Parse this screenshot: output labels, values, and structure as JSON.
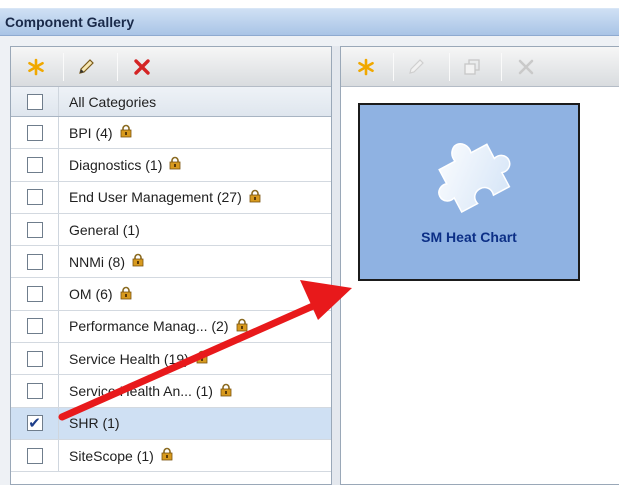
{
  "window": {
    "title": "Component Gallery"
  },
  "left_toolbar": {
    "buttons": [
      {
        "name": "new-icon",
        "color": "#f0a800"
      },
      {
        "name": "edit-icon",
        "color": "#8a6a2a"
      },
      {
        "name": "delete-icon",
        "color": "#d42424"
      }
    ]
  },
  "categories": {
    "header_label": "All Categories",
    "items": [
      {
        "label": "BPI (4)",
        "locked": true,
        "checked": false
      },
      {
        "label": "Diagnostics (1)",
        "locked": true,
        "checked": false
      },
      {
        "label": "End User Management (27)",
        "locked": true,
        "checked": false
      },
      {
        "label": "General (1)",
        "locked": false,
        "checked": false
      },
      {
        "label": "NNMi (8)",
        "locked": true,
        "checked": false
      },
      {
        "label": "OM (6)",
        "locked": true,
        "checked": false
      },
      {
        "label": "Performance Manag... (2)",
        "locked": true,
        "checked": false
      },
      {
        "label": "Service Health (19)",
        "locked": true,
        "checked": false
      },
      {
        "label": "Service Health An... (1)",
        "locked": true,
        "checked": false
      },
      {
        "label": "SHR (1)",
        "locked": false,
        "checked": true
      },
      {
        "label": "SiteScope (1)",
        "locked": true,
        "checked": false
      }
    ]
  },
  "right_toolbar": {
    "buttons": [
      {
        "name": "new-icon",
        "enabled": true
      },
      {
        "name": "edit-icon",
        "enabled": false
      },
      {
        "name": "duplicate-icon",
        "enabled": false
      },
      {
        "name": "delete-icon",
        "enabled": false
      }
    ]
  },
  "gallery": {
    "tiles": [
      {
        "title": "SM Heat Chart",
        "icon": "puzzle-piece-icon",
        "background": "#8fb2e2"
      }
    ]
  },
  "colors": {
    "accent": "#0c2f86",
    "selected_row": "#cfe0f3",
    "annotation_arrow": "#e8191b"
  }
}
